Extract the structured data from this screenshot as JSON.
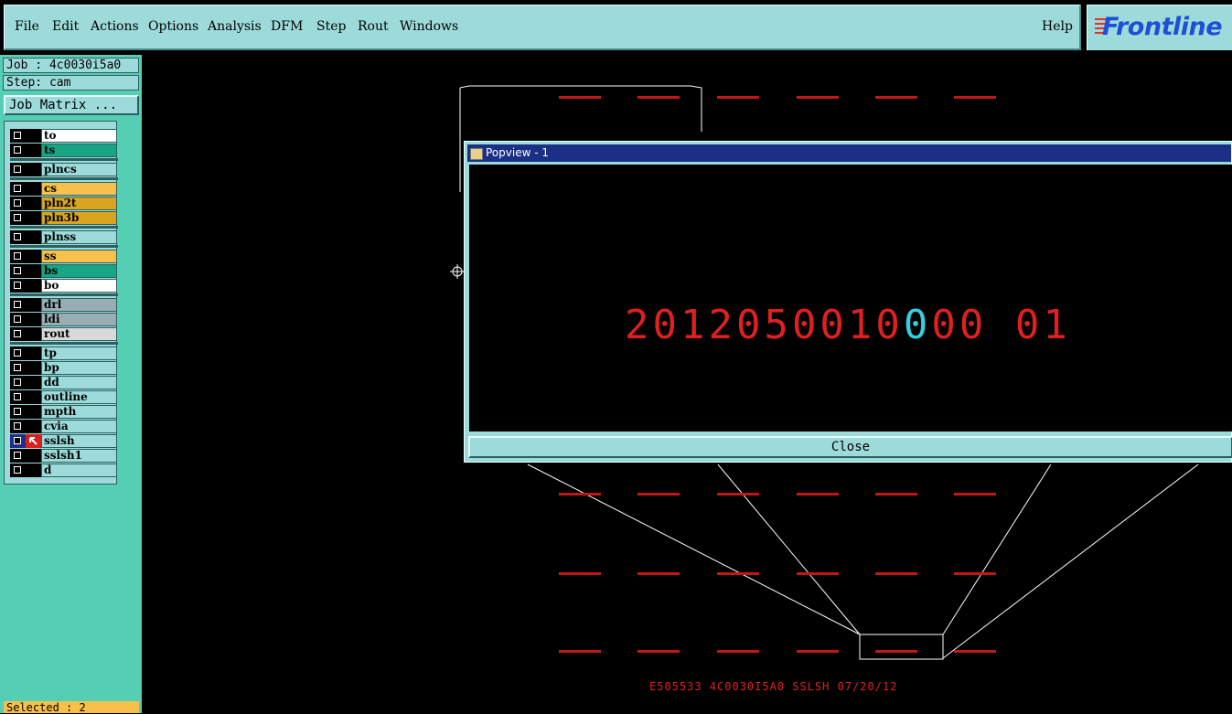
{
  "menu": {
    "items": [
      "File",
      "Edit",
      "Actions",
      "Options",
      "Analysis",
      "DFM",
      "Step",
      "Rout",
      "Windows"
    ],
    "help": "Help",
    "logo": "Frontline"
  },
  "sidebar": {
    "job": "Job : 4c0030i5a0",
    "step": "Step: cam",
    "job_matrix": "Job Matrix ...",
    "layers": [
      {
        "name": "to",
        "color": "#ffffff"
      },
      {
        "name": "ts",
        "color": "#17a583"
      },
      {
        "name": "plncs",
        "color": "#9ddbdb"
      },
      {
        "name": "cs",
        "color": "#f6c04a"
      },
      {
        "name": "pln2t",
        "color": "#d9a520"
      },
      {
        "name": "pln3b",
        "color": "#d9a520"
      },
      {
        "name": "plnss",
        "color": "#9ddbdb"
      },
      {
        "name": "ss",
        "color": "#f6c04a"
      },
      {
        "name": "bs",
        "color": "#17a583"
      },
      {
        "name": "bo",
        "color": "#ffffff"
      },
      {
        "name": "drl",
        "color": "#98aeb4"
      },
      {
        "name": "ldi",
        "color": "#98aeb4"
      },
      {
        "name": "rout",
        "color": "#d9d9d9"
      },
      {
        "name": "tp",
        "color": "#9ddbdb"
      },
      {
        "name": "bp",
        "color": "#9ddbdb"
      },
      {
        "name": "dd",
        "color": "#9ddbdb"
      },
      {
        "name": "outline",
        "color": "#9ddbdb"
      },
      {
        "name": "mpth",
        "color": "#9ddbdb"
      },
      {
        "name": "cvia",
        "color": "#9ddbdb"
      },
      {
        "name": "sslsh",
        "color": "#9ddbdb"
      },
      {
        "name": "sslsh1",
        "color": "#9ddbdb"
      },
      {
        "name": "d",
        "color": "#9ddbdb"
      }
    ],
    "selected": "Selected : 2"
  },
  "popup": {
    "title": "Popview - 1",
    "digits_a": "2012050010",
    "digits_cursor": "0",
    "digits_b": "00 01",
    "close": "Close"
  },
  "canvas": {
    "bottom_label": "E505533 4C0030I5A0 SSLSH 07/20/12"
  }
}
